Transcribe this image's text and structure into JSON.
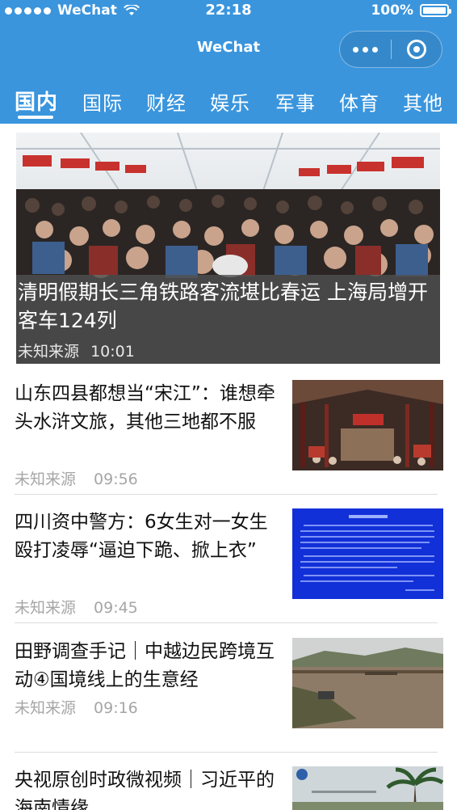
{
  "status_bar": {
    "carrier": "WeChat",
    "time": "22:18",
    "battery": "100%"
  },
  "nav": {
    "title": "WeChat"
  },
  "tabs": [
    {
      "label": "国内",
      "active": true
    },
    {
      "label": "国际"
    },
    {
      "label": "财经"
    },
    {
      "label": "娱乐"
    },
    {
      "label": "军事"
    },
    {
      "label": "体育"
    },
    {
      "label": "其他"
    }
  ],
  "hero": {
    "title": "清明假期长三角铁路客流堪比春运 上海局增开客车124列",
    "source": "未知来源",
    "time": "10:01"
  },
  "articles": [
    {
      "title": "山东四县都想当“宋江”：谁想牵头水浒文旅，其他三地都不服",
      "source": "未知来源",
      "time": "09:56"
    },
    {
      "title": "四川资中警方：6女生对一女生殴打凌辱“逼迫下跪、掀上衣”",
      "source": "未知来源",
      "time": "09:45"
    },
    {
      "title": "田野调查手记｜中越边民跨境互动④国境线上的生意经",
      "source": "未知来源",
      "time": "09:16"
    },
    {
      "title": "央视原创时政微视频｜习近平的海南情缘"
    }
  ],
  "colors": {
    "header": "#3a95dd",
    "meta_text": "#a6a6a6",
    "hero_overlay": "#505050"
  },
  "icons": [
    "signal-dots-icon",
    "wifi-icon",
    "battery-icon",
    "more-icon",
    "close-mini-program-icon"
  ]
}
